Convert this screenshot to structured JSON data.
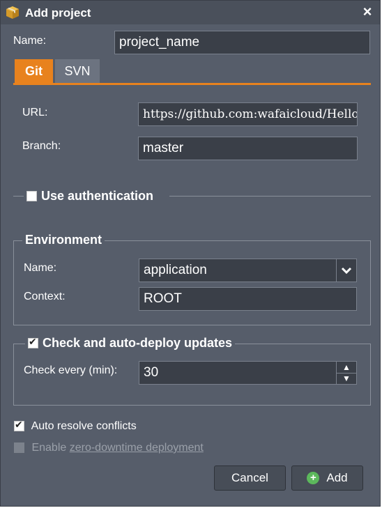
{
  "dialog": {
    "title": "Add project",
    "close_icon": "×"
  },
  "project": {
    "name_label": "Name:",
    "name_value": "project_name"
  },
  "tabs": [
    {
      "label": "Git",
      "active": true
    },
    {
      "label": "SVN",
      "active": false
    }
  ],
  "repo": {
    "url_label": "URL:",
    "url_value": "https://github.com:wafaicloud/Hello",
    "branch_label": "Branch:",
    "branch_value": "master"
  },
  "auth": {
    "label": "Use authentication",
    "checked": false
  },
  "environment": {
    "legend": "Environment",
    "name_label": "Name:",
    "name_value": "application",
    "context_label": "Context:",
    "context_value": "ROOT"
  },
  "autodeploy": {
    "legend": "Check and auto-deploy updates",
    "checked": true,
    "interval_label": "Check every (min):",
    "interval_value": "30"
  },
  "options": {
    "auto_resolve_label": "Auto resolve conflicts",
    "auto_resolve_checked": true,
    "zero_downtime_prefix": "Enable ",
    "zero_downtime_link": "zero-downtime deployment",
    "zero_downtime_enabled": false
  },
  "buttons": {
    "cancel": "Cancel",
    "add": "Add"
  },
  "colors": {
    "accent": "#e8821e",
    "panel": "#565d6a",
    "add_icon": "#5cb85c"
  }
}
